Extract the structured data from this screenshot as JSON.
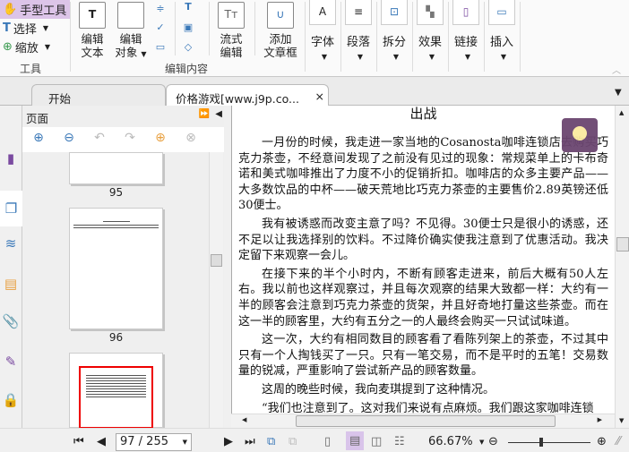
{
  "ribbon": {
    "tools": {
      "hand": "手型工具",
      "select": "选择",
      "zoom": "缩放",
      "group": "工具"
    },
    "edit": {
      "edit_text": [
        "编辑",
        "文本"
      ],
      "edit_object": [
        "编辑",
        "对象"
      ],
      "flow_edit": [
        "流式",
        "编辑"
      ],
      "add_frame": [
        "添加",
        "文章框"
      ],
      "group": "编辑内容"
    },
    "boxes": [
      "字体",
      "段落",
      "拆分",
      "效果",
      "链接",
      "插入"
    ]
  },
  "tabs": [
    {
      "label": "开始"
    },
    {
      "label": "价格游戏[www.j9p.co...",
      "close": "×"
    }
  ],
  "panel": {
    "title": "页面",
    "thumbs": [
      "95",
      "96"
    ]
  },
  "document": {
    "title": "出战",
    "paragraphs": [
      "一月份的时候，我走进一家当地的Cosanosta咖啡连锁店去购买巧克力茶壶，不经意间发现了之前没有见过的现象：常规菜单上的卡布奇诺和美式咖啡推出了力度不小的促销折扣。咖啡店的众多主要产品——大多数饮品的中杯——破天荒地比巧克力茶壶的主要售价2.89英镑还低30便士。",
      "我有被诱惑而改变主意了吗？不见得。30便士只是很小的诱惑，还不足以让我选择别的饮料。不过降价确实使我注意到了优惠活动。我决定留下来观察一会儿。",
      "在接下来的半个小时内，不断有顾客走进来，前后大概有50人左右。我以前也这样观察过，并且每次观察的结果大致都一样：大约有一半的顾客会注意到巧克力茶壶的货架，并且好奇地打量这些茶壶。而在这一半的顾客里，大约有五分之一的人最终会购买一只试试味道。",
      "这一次，大约有相同数目的顾客看了看陈列架上的茶壶，不过其中只有一个人掏钱买了一只。只有一笔交易，而不是平时的五笔！交易数量的锐减，严重影响了尝试新产品的顾客数量。",
      "这周的晚些时候，我向麦琪提到了这种情况。",
      "“我们也注意到了。这对我们来说有点麻烦。我们跟这家咖啡连锁"
    ]
  },
  "status": {
    "page": "97 / 255",
    "zoom": "66.67%",
    "zoom_slider_fraction": 0.5
  }
}
